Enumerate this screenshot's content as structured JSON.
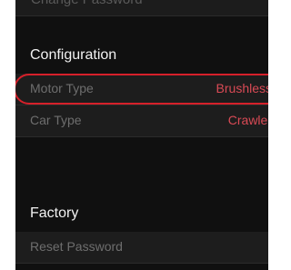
{
  "previous_section": {
    "row_label": "Change Password"
  },
  "configuration": {
    "header": "Configuration",
    "items": [
      {
        "label": "Motor Type",
        "value": "Brushless"
      },
      {
        "label": "Car Type",
        "value": "Crawler"
      }
    ]
  },
  "factory": {
    "header": "Factory",
    "items": [
      {
        "label": "Reset Password"
      }
    ]
  },
  "colors": {
    "background": "#101010",
    "row_background": "#1d1d1d",
    "value_accent": "#d94a55",
    "highlight_ring": "#d6202a"
  }
}
